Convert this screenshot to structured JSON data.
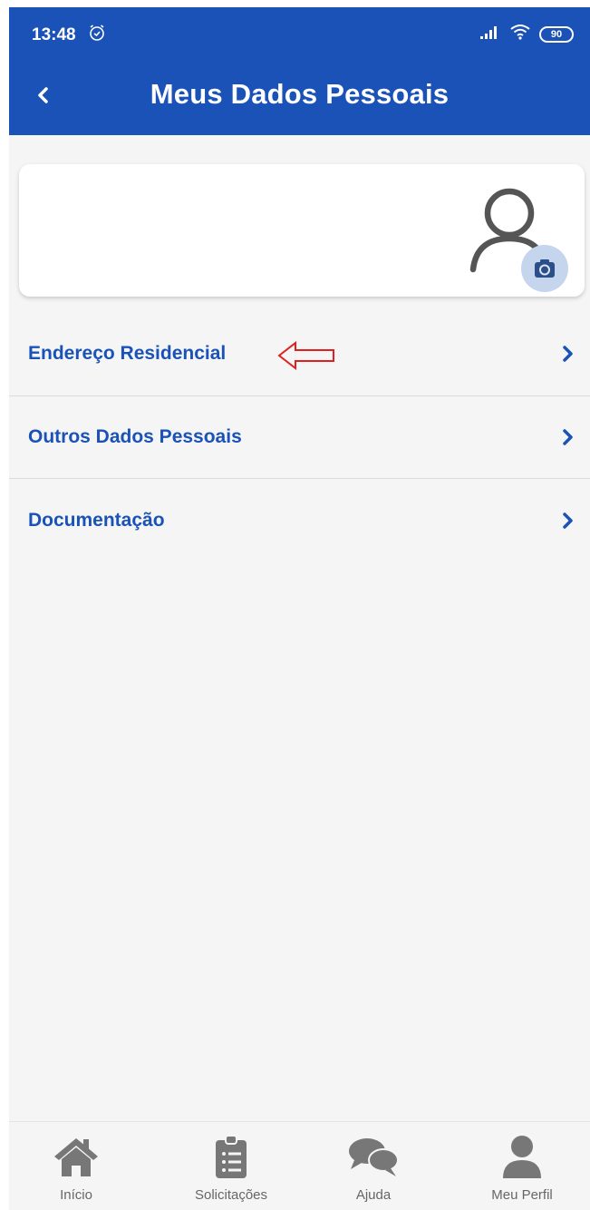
{
  "status_bar": {
    "time": "13:48",
    "battery": "90",
    "icons": [
      "alarm-icon",
      "signal-icon",
      "wifi-icon",
      "battery-icon"
    ]
  },
  "header": {
    "title": "Meus Dados Pessoais",
    "back_icon": "chevron-left-icon"
  },
  "profile_card": {
    "avatar_icon": "user-outline-icon",
    "camera_icon": "camera-icon"
  },
  "menu": {
    "items": [
      {
        "label": "Endereço Residencial",
        "icon": "chevron-right-icon"
      },
      {
        "label": "Outros Dados Pessoais",
        "icon": "chevron-right-icon"
      },
      {
        "label": "Documentação",
        "icon": "chevron-right-icon"
      }
    ]
  },
  "annotation": {
    "icon": "red-outline-arrow-left",
    "color": "#e02020"
  },
  "bottom_nav": {
    "items": [
      {
        "label": "Início",
        "icon": "home-icon"
      },
      {
        "label": "Solicitações",
        "icon": "clipboard-list-icon"
      },
      {
        "label": "Ajuda",
        "icon": "chat-bubbles-icon"
      },
      {
        "label": "Meu Perfil",
        "icon": "user-icon"
      }
    ]
  },
  "colors": {
    "primary": "#1a52b8",
    "background": "#f5f5f5",
    "card": "#ffffff",
    "nav_icon": "#777777",
    "camera_badge": "#c6d5ee"
  }
}
